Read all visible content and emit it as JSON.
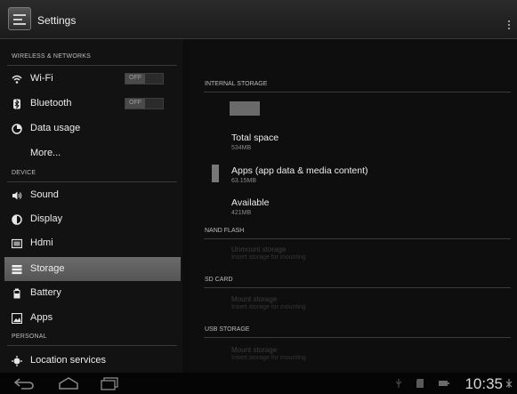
{
  "header": {
    "title": "Settings"
  },
  "sidebar": {
    "sections": [
      {
        "label": "WIRELESS & NETWORKS"
      },
      {
        "label": "DEVICE"
      },
      {
        "label": "PERSONAL"
      }
    ],
    "items": [
      {
        "label": "Wi-Fi",
        "icon": "wifi-icon",
        "toggle": "OFF"
      },
      {
        "label": "Bluetooth",
        "icon": "bluetooth-icon",
        "toggle": "OFF"
      },
      {
        "label": "Data usage",
        "icon": "data-usage-icon"
      },
      {
        "label": "More..."
      },
      {
        "label": "Sound",
        "icon": "sound-icon"
      },
      {
        "label": "Display",
        "icon": "display-icon"
      },
      {
        "label": "Hdmi",
        "icon": "hdmi-icon"
      },
      {
        "label": "Storage",
        "icon": "storage-icon",
        "selected": true
      },
      {
        "label": "Battery",
        "icon": "battery-icon"
      },
      {
        "label": "Apps",
        "icon": "apps-icon"
      },
      {
        "label": "Location services",
        "icon": "location-icon"
      }
    ]
  },
  "main": {
    "internal_header": "INTERNAL STORAGE",
    "total": {
      "label": "Total space",
      "value": "534MB"
    },
    "apps": {
      "label": "Apps (app data & media content)",
      "value": "63.15MB"
    },
    "available": {
      "label": "Available",
      "value": "421MB"
    },
    "nand_header": "NAND FLASH",
    "nand_item": {
      "label": "Unmount storage",
      "sub": "Insert storage for mounting"
    },
    "sd_header": "SD CARD",
    "sd_item": {
      "label": "Mount storage",
      "sub": "Insert storage for mounting"
    },
    "usb_header": "USB STORAGE",
    "usb_item": {
      "label": "Mount storage",
      "sub": "Insert storage for mounting"
    }
  },
  "statusbar": {
    "time": "10:35"
  }
}
